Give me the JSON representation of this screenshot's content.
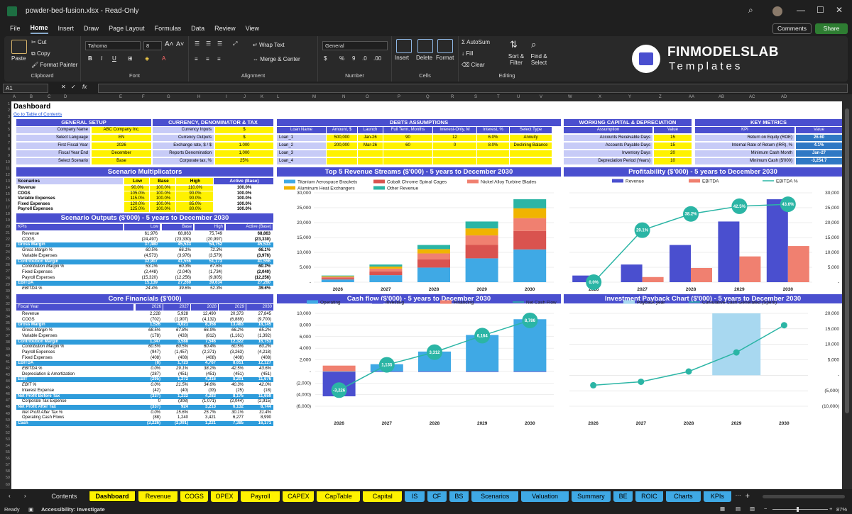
{
  "window": {
    "title": "powder-bed-fusion.xlsx  -  Read-Only"
  },
  "menu": [
    "File",
    "Home",
    "Insert",
    "Draw",
    "Page Layout",
    "Formulas",
    "Data",
    "Review",
    "View"
  ],
  "header_buttons": {
    "comments": "Comments",
    "share": "Share"
  },
  "ribbon": {
    "clipboard": {
      "paste": "Paste",
      "cut": "Cut",
      "copy": "Copy",
      "format_painter": "Format Painter",
      "label": "Clipboard"
    },
    "font": {
      "name": "Tahoma",
      "size": "8",
      "label": "Font"
    },
    "alignment": {
      "wrap": "Wrap Text",
      "merge": "Merge & Center",
      "label": "Alignment"
    },
    "number": {
      "format": "General",
      "label": "Number"
    },
    "cells": {
      "insert": "Insert",
      "delete": "Delete",
      "format": "Format",
      "label": "Cells"
    },
    "editing": {
      "autosum": "AutoSum",
      "fill": "Fill",
      "clear": "Clear",
      "sort": "Sort & Filter",
      "find": "Find & Select",
      "label": "Editing"
    },
    "brand": {
      "name": "FINMODELSLAB",
      "sub": "Templates"
    }
  },
  "formula_bar": {
    "cell": "A1",
    "fx": "fx"
  },
  "columns": [
    "A",
    "B",
    "C",
    "D",
    "E",
    "F",
    "G",
    "H",
    "I",
    "J",
    "K",
    "L",
    "M",
    "N",
    "O",
    "P",
    "Q",
    "R",
    "S",
    "T",
    "U",
    "V",
    "W",
    "X",
    "Y",
    "Z",
    "AA",
    "AB",
    "AC",
    "AD"
  ],
  "sheet": {
    "title": "Dashboard",
    "toc_link": "Go to Table of Contents",
    "general_setup": {
      "header": "GENERAL SETUP",
      "rows": [
        [
          "Company Name",
          "ABC Company Inc."
        ],
        [
          "Select Language",
          "EN"
        ],
        [
          "First Fiscal Year",
          "2026"
        ],
        [
          "Fiscal Year End",
          "December"
        ],
        [
          "Select Scenario",
          "Base"
        ]
      ]
    },
    "currency": {
      "header": "CURRENCY, DENOMINATOR & TAX",
      "rows": [
        [
          "Currency Inputs",
          "$"
        ],
        [
          "Currency Outputs",
          "$"
        ],
        [
          "Exchange rate, $ / $",
          "1.000"
        ],
        [
          "Reports Denomination",
          "1,000"
        ],
        [
          "Corporate tax, %",
          "25%"
        ]
      ]
    },
    "debts": {
      "header": "DEBTS ASSUMPTIONS",
      "cols": [
        "Loan Name",
        "Amount, $",
        "Launch",
        "Full Term, Months",
        "Interest-Only, M",
        "Interest, %",
        "Select Type"
      ],
      "rows": [
        [
          "Loan_1",
          "500,000",
          "Jan-26",
          "90",
          "12",
          "6.0%",
          "Annuity"
        ],
        [
          "Loan_2",
          "200,000",
          "Mar-26",
          "60",
          "0",
          "8.0%",
          "Declining Balance"
        ],
        [
          "Loan_3",
          "",
          "",
          "",
          "",
          "",
          ""
        ],
        [
          "Loan_4",
          "",
          "",
          "",
          "",
          "",
          ""
        ]
      ]
    },
    "working_capital": {
      "header": "WORKING CAPITAL & DEPRECIATION",
      "cols": [
        "Assumption",
        "Value"
      ],
      "rows": [
        [
          "Accounts Receivable Days",
          "15"
        ],
        [
          "Accounts Payable Days",
          "15"
        ],
        [
          "Inventory Days",
          "20"
        ],
        [
          "Depreciation Period (Years)",
          "10"
        ]
      ]
    },
    "key_metrics": {
      "header": "KEY METRICS",
      "cols": [
        "KPI",
        "Value"
      ],
      "rows": [
        [
          "Return on Equity (ROE)",
          "26.60"
        ],
        [
          "Internal Rate of Return (IRR), %",
          "4.1%"
        ],
        [
          "Minimum Cash Month",
          "Jan-27"
        ],
        [
          "Minimum Cash ($'000)",
          "-3,254.7"
        ]
      ]
    },
    "scenario_multipliers": {
      "header": "Scenario Multiplicators",
      "cols": [
        "Scenarios",
        "Low",
        "Base",
        "High",
        "Active (Base)"
      ],
      "rows": [
        [
          "Revenue",
          "90.0%",
          "100.0%",
          "110.0%",
          "100.0%"
        ],
        [
          "COGS",
          "105.0%",
          "100.0%",
          "90.0%",
          "100.0%"
        ],
        [
          "Variable Expenses",
          "115.0%",
          "100.0%",
          "90.0%",
          "100.0%"
        ],
        [
          "Fixed Expenses",
          "120.0%",
          "100.0%",
          "85.0%",
          "100.0%"
        ],
        [
          "Payroll Expenses",
          "125.0%",
          "100.0%",
          "80.0%",
          "100.0%"
        ]
      ]
    },
    "scenario_outputs": {
      "header": "Scenario Outputs ($'000) - 5 years to December 2030",
      "cols": [
        "KPIs",
        "Low",
        "Base",
        "High",
        "Active (Base)"
      ],
      "rows": [
        [
          "Revenue",
          "61,976",
          "68,863",
          "75,749",
          "68,863",
          "n"
        ],
        [
          "COGS",
          "(24,497)",
          "(23,330)",
          "(20,997)",
          "(23,330)",
          "n"
        ],
        [
          "Gross Margin",
          "37,480",
          "45,533",
          "54,752",
          "45,533",
          "h"
        ],
        [
          "Gross Margin %",
          "60.5%",
          "66.1%",
          "72.3%",
          "66.1%",
          "i"
        ],
        [
          "Variable Expenses",
          "(4,573)",
          "(3,976)",
          "(3,579)",
          "(3,976)",
          "n"
        ],
        [
          "Contribution Margin",
          "32,907",
          "41,556",
          "51,173",
          "41,556",
          "h"
        ],
        [
          "Contribution Margin %",
          "53.1%",
          "60.3%",
          "67.6%",
          "60.3%",
          "i"
        ],
        [
          "Fixed Expenses",
          "(2,448)",
          "(2,040)",
          "(1,734)",
          "(2,040)",
          "n"
        ],
        [
          "Payroll Expenses",
          "(15,320)",
          "(12,256)",
          "(9,805)",
          "(12,256)",
          "n"
        ],
        [
          "EBITDA",
          "15,139",
          "27,260",
          "39,634",
          "27,260",
          "h"
        ],
        [
          "EBITDA %",
          "24.4%",
          "39.6%",
          "52.3%",
          "39.6%",
          "i"
        ]
      ]
    },
    "core_financials": {
      "header": "Core Financials ($'000)",
      "cols": [
        "Fiscal Year",
        "2026",
        "2027",
        "2028",
        "2029",
        "2030"
      ],
      "rows": [
        [
          "Revenue",
          "2,228",
          "5,928",
          "12,490",
          "20,373",
          "27,845",
          "n"
        ],
        [
          "COGS",
          "(702)",
          "(1,907)",
          "(4,132)",
          "(6,889)",
          "(9,700)",
          "n"
        ],
        [
          "Gross Margin",
          "1,526",
          "4,021",
          "8,358",
          "13,483",
          "18,145",
          "h"
        ],
        [
          "Gross Margin %",
          "68.5%",
          "67.8%",
          "66.9%",
          "66.2%",
          "65.2%",
          "i"
        ],
        [
          "Variable Expenses",
          "(178)",
          "(433)",
          "(812)",
          "(1,161)",
          "(1,392)",
          "n"
        ],
        [
          "Contribution Margin",
          "1,347",
          "3,588",
          "7,546",
          "12,322",
          "16,753",
          "h"
        ],
        [
          "Contribution Margin %",
          "60.5%",
          "60.5%",
          "60.4%",
          "60.5%",
          "60.2%",
          "i"
        ],
        [
          "Payroll Expenses",
          "(947)",
          "(1,457)",
          "(2,371)",
          "(3,263)",
          "(4,218)",
          "n"
        ],
        [
          "Fixed Expenses",
          "(408)",
          "(408)",
          "(408)",
          "(408)",
          "(408)",
          "n"
        ],
        [
          "EBITDA",
          "(8)",
          "1,723",
          "4,767",
          "8,651",
          "12,127",
          "h"
        ],
        [
          "EBITDA %",
          "0.0%",
          "29.1%",
          "38.2%",
          "42.5%",
          "43.6%",
          "i"
        ],
        [
          "Depreciation & Amortization",
          "(287)",
          "(451)",
          "(451)",
          "(451)",
          "(451)",
          "n"
        ],
        [
          "EBIT",
          "(295)",
          "1,272",
          "4,316",
          "8,201",
          "11,676",
          "h"
        ],
        [
          "EBIT %",
          "0.0%",
          "21.5%",
          "34.6%",
          "40.3%",
          "42.0%",
          "i"
        ],
        [
          "Interest Expense",
          "(42)",
          "(40)",
          "(33)",
          "(25)",
          "(18)",
          "n"
        ],
        [
          "Net Profit Before Tax",
          "(337)",
          "1,232",
          "4,283",
          "8,175",
          "11,659",
          "h"
        ],
        [
          "Corporate Tax Expense",
          "0",
          "(308)",
          "(1,071)",
          "(2,044)",
          "(2,915)",
          "n"
        ],
        [
          "Net Profit After Tax",
          "(337)",
          "924",
          "3,213",
          "6,132",
          "8,744",
          "h"
        ],
        [
          "Net Profit After Tax %",
          "0.0%",
          "15.6%",
          "25.7%",
          "30.1%",
          "31.4%",
          "i"
        ],
        [
          "Operating Cash Flows",
          "(88)",
          "1,240",
          "3,421",
          "6,277",
          "8,990",
          "n"
        ],
        [
          "Cash",
          "(3,226)",
          "(2,091)",
          "1,221",
          "7,385",
          "16,171",
          "h"
        ]
      ]
    }
  },
  "charts": [
    {
      "title": "Top 5 Revenue Streams ($'000) - 5 years to December 2030",
      "type": "bar",
      "stacked": true,
      "categories": [
        "2026",
        "2027",
        "2028",
        "2029",
        "2030"
      ],
      "ylim": [
        0,
        30000
      ],
      "yticks": [
        "-",
        "5,000",
        "10,000",
        "15,000",
        "20,000",
        "25,000",
        "30,000"
      ],
      "series": [
        {
          "name": "Titanium Aerospace Brackets",
          "color": "#3fa9e5",
          "values": [
            900,
            2350,
            4900,
            8000,
            11000
          ]
        },
        {
          "name": "Cobalt Chrome Spinal Cages",
          "color": "#d9534f",
          "values": [
            500,
            1300,
            2800,
            4500,
            6200
          ]
        },
        {
          "name": "Nickel Alloy Turbine Blades",
          "color": "#f08070",
          "values": [
            350,
            900,
            1950,
            3200,
            4300
          ]
        },
        {
          "name": "Aluminum Heat Exchangers",
          "color": "#f0b400",
          "values": [
            250,
            700,
            1450,
            2350,
            3300
          ]
        },
        {
          "name": "Other Revenue",
          "color": "#2bb5a5",
          "values": [
            230,
            678,
            1390,
            2323,
            3045
          ]
        }
      ]
    },
    {
      "title": "Profitability ($'000) - 5 years to December 2030",
      "type": "bar-line",
      "categories": [
        "2026",
        "2027",
        "2028",
        "2029",
        "2030"
      ],
      "ylim": [
        0,
        30000
      ],
      "yticks": [
        "-",
        "5,000",
        "10,000",
        "15,000",
        "20,000",
        "25,000",
        "30,000"
      ],
      "series": [
        {
          "name": "Revenue",
          "color": "#4a4fcf",
          "values": [
            2228,
            5928,
            12490,
            20373,
            27845
          ]
        },
        {
          "name": "EBITDA",
          "color": "#f08070",
          "values": [
            -8,
            1723,
            4767,
            8651,
            12127
          ]
        },
        {
          "name": "EBITDA %",
          "color": "#2bb5a5",
          "values": [
            0.0,
            29.1,
            38.2,
            42.5,
            43.6
          ],
          "labels": [
            "0.0%",
            "29.1%",
            "38.2%",
            "42.5%",
            "43.6%"
          ]
        }
      ]
    },
    {
      "title": "Cash flow ($'000) - 5 years to December 2030",
      "type": "bar-line",
      "categories": [
        "2026",
        "2027",
        "2028",
        "2029",
        "2030"
      ],
      "ylim": [
        -6000,
        10000
      ],
      "yticks": [
        "(6,000)",
        "(4,000)",
        "(2,000)",
        "-",
        "2,000",
        "4,000",
        "6,000",
        "8,000",
        "10,000"
      ],
      "series": [
        {
          "name": "Operating",
          "color": "#3fa9e5",
          "values": [
            -88,
            1240,
            3421,
            6277,
            8990
          ]
        },
        {
          "name": "Investing",
          "color": "#4a4fcf",
          "values": [
            -4200,
            -100,
            -100,
            -100,
            -100
          ]
        },
        {
          "name": "Financing",
          "color": "#f08070",
          "values": [
            1000,
            0,
            0,
            0,
            0
          ]
        },
        {
          "name": "Net Cash Flow",
          "color": "#2bb5a5",
          "values": [
            -3226,
            1135,
            3312,
            6164,
            8786
          ],
          "labels": [
            "-3,226",
            "1,135",
            "3,312",
            "6,164",
            "8,786"
          ]
        }
      ]
    },
    {
      "title": "Investment Payback Chart ($'000) - 5 years to December 2030",
      "type": "bar-line",
      "categories": [
        "2026",
        "2027",
        "2028",
        "2029",
        "2030"
      ],
      "ylim": [
        -10000,
        20000
      ],
      "yticks": [
        "(10,000)",
        "(5,000)",
        "-",
        "5,000",
        "10,000",
        "15,000",
        "20,000"
      ],
      "series": [
        {
          "name": "Payback year",
          "color": "#a8d8f0",
          "values": [
            0,
            0,
            0,
            20000,
            0
          ]
        },
        {
          "name": "Cumulative Cash Generated (Spent)",
          "color": "#2bb5a5",
          "values": [
            -3226,
            -2091,
            1221,
            7385,
            16171
          ]
        }
      ]
    }
  ],
  "tabs": [
    {
      "label": "Contents",
      "color": "#1f1f1f",
      "fg": "#ddd"
    },
    {
      "label": "Dashboard",
      "color": "#fff200",
      "fg": "#000",
      "active": true
    },
    {
      "label": "Revenue",
      "color": "#fff200"
    },
    {
      "label": "COGS",
      "color": "#fff200"
    },
    {
      "label": "OPEX",
      "color": "#fff200"
    },
    {
      "label": "Payroll",
      "color": "#fff200"
    },
    {
      "label": "CAPEX",
      "color": "#fff200"
    },
    {
      "label": "CapTable",
      "color": "#fff200"
    },
    {
      "label": "Capital",
      "color": "#fff200"
    },
    {
      "label": "IS",
      "color": "#3fa9e5"
    },
    {
      "label": "CF",
      "color": "#3fa9e5"
    },
    {
      "label": "BS",
      "color": "#3fa9e5"
    },
    {
      "label": "Scenarios",
      "color": "#3fa9e5"
    },
    {
      "label": "Valuation",
      "color": "#3fa9e5"
    },
    {
      "label": "Summary",
      "color": "#3fa9e5"
    },
    {
      "label": "BE",
      "color": "#3fa9e5"
    },
    {
      "label": "ROIC",
      "color": "#3fa9e5"
    },
    {
      "label": "Charts",
      "color": "#3fa9e5"
    },
    {
      "label": "KPIs",
      "color": "#3fa9e5"
    }
  ],
  "status": {
    "ready": "Ready",
    "accessibility": "Accessibility: Investigate",
    "zoom": "87%"
  }
}
